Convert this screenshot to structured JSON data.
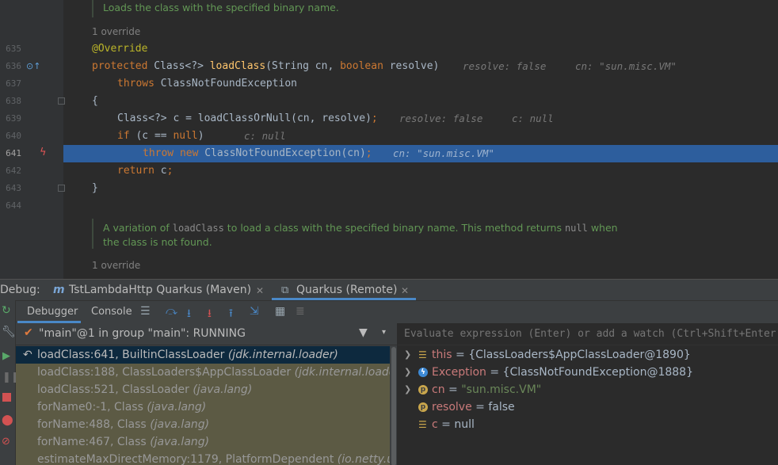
{
  "editor": {
    "doc_top": "Loads the class with the specified binary name.",
    "override_1": "1 override",
    "lines": {
      "635": {
        "num": "635"
      },
      "636": {
        "num": "636",
        "hint_resolve": "resolve: false",
        "hint_cn": "cn: \"sun.misc.VM\""
      },
      "637": {
        "num": "637"
      },
      "638": {
        "num": "638"
      },
      "639": {
        "num": "639",
        "hint_resolve": "resolve: false",
        "hint_c": "c: null"
      },
      "640": {
        "num": "640",
        "hint_c": "c: null"
      },
      "641": {
        "num": "641",
        "hint_cn": "cn: \"sun.misc.VM\""
      },
      "642": {
        "num": "642"
      },
      "643": {
        "num": "643"
      },
      "644": {
        "num": "644"
      }
    },
    "doc_bottom_a": "A variation of ",
    "doc_bottom_code1": "loadClass",
    "doc_bottom_b": " to load a class with the specified binary name. This method returns ",
    "doc_bottom_code2": "null",
    "doc_bottom_c": " when",
    "doc_bottom_line2": "the class is not found.",
    "override_2": "1 override"
  },
  "debug": {
    "label": "Debug:",
    "tabs": [
      {
        "label": "TstLambdaHttp Quarkus (Maven)"
      },
      {
        "label": "Quarkus (Remote)"
      }
    ],
    "toolbar_tabs": {
      "debugger": "Debugger",
      "console": "Console"
    },
    "thread": "\"main\"@1 in group \"main\": RUNNING",
    "frames": [
      {
        "method": "loadClass:641, BuiltinClassLoader",
        "pkg": "(jdk.internal.loader)"
      },
      {
        "method": "loadClass:188, ClassLoaders$AppClassLoader",
        "pkg": "(jdk.internal.loader)"
      },
      {
        "method": "loadClass:521, ClassLoader",
        "pkg": "(java.lang)"
      },
      {
        "method": "forName0:-1, Class",
        "pkg": "(java.lang)"
      },
      {
        "method": "forName:488, Class",
        "pkg": "(java.lang)"
      },
      {
        "method": "forName:467, Class",
        "pkg": "(java.lang)"
      },
      {
        "method": "estimateMaxDirectMemory:1179, PlatformDependent",
        "pkg": "(io.netty.util"
      }
    ],
    "eval_placeholder": "Evaluate expression (Enter) or add a watch (Ctrl+Shift+Enter)",
    "variables": [
      {
        "name": "this",
        "value": "{ClassLoaders$AppClassLoader@1890}"
      },
      {
        "name": "Exception",
        "value": "{ClassNotFoundException@1888}"
      },
      {
        "name": "cn",
        "value": "\"sun.misc.VM\""
      },
      {
        "name": "resolve",
        "value": "false"
      },
      {
        "name": "c",
        "value": "null"
      }
    ]
  },
  "colors": {
    "accent": "#4a88c7",
    "selected_line": "#2d5e9d",
    "keyword": "#cc7832",
    "annotation": "#bbb529",
    "method_decl": "#ffc66d",
    "javadoc": "#629755",
    "frame_bg": "#5c5a44"
  }
}
